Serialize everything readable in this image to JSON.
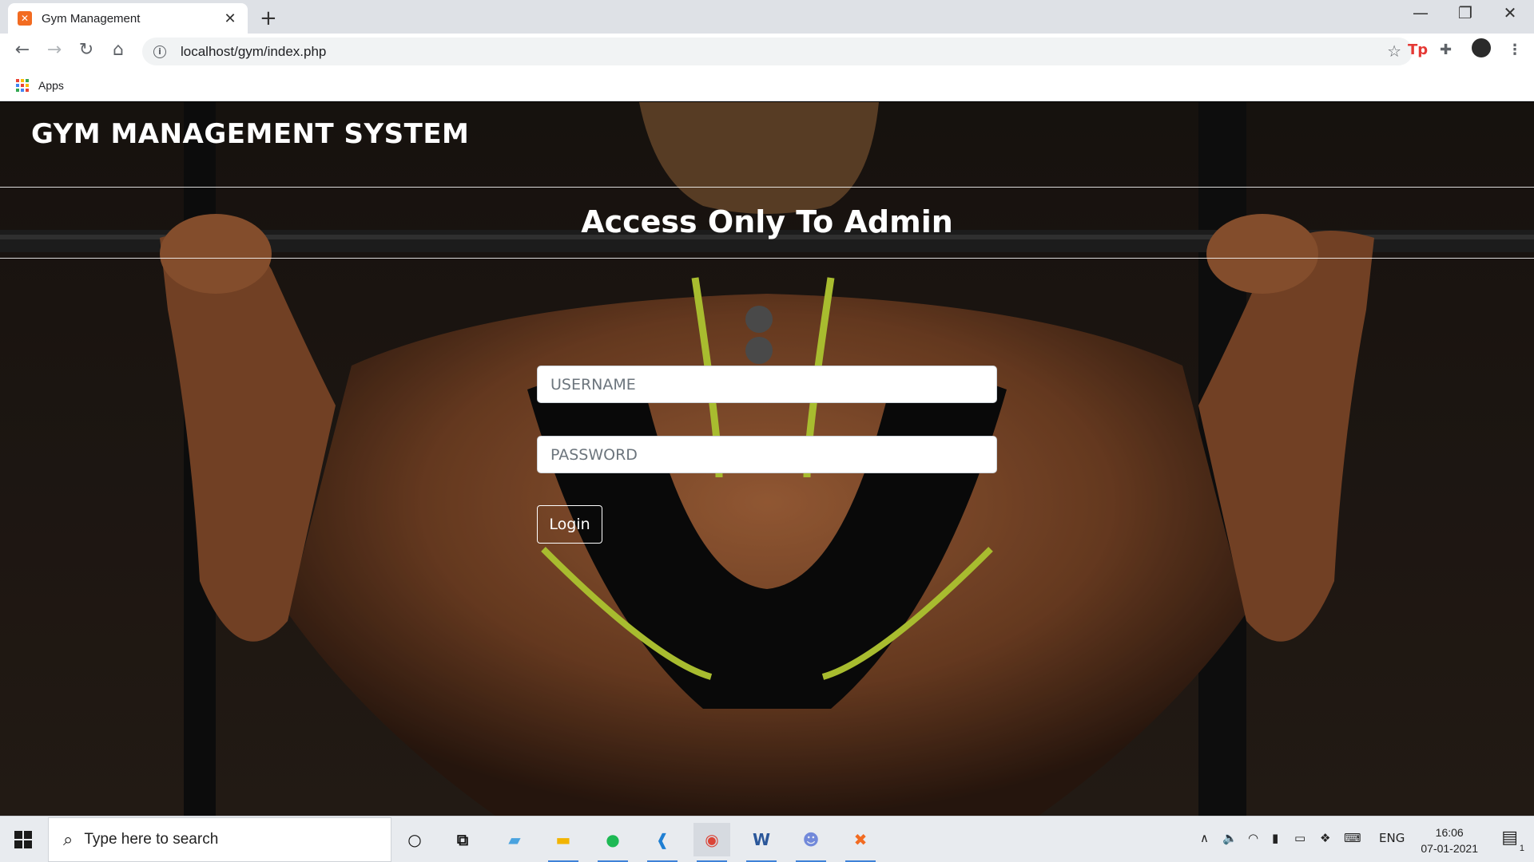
{
  "browser": {
    "tab_title": "Gym Management",
    "tab_favicon": "xampp-icon",
    "url": "localhost/gym/index.php",
    "bookmarks_apps_label": "Apps"
  },
  "page": {
    "site_title": "GYM MANAGEMENT SYSTEM",
    "subtitle": "Access Only To Admin",
    "username_placeholder": "USERNAME",
    "password_placeholder": "PASSWORD",
    "login_label": "Login"
  },
  "taskbar": {
    "search_placeholder": "Type here to search",
    "apps": [
      "cortana-icon",
      "task-view-icon",
      "desktop-app-icon",
      "file-explorer-icon",
      "spotify-icon",
      "vscode-icon",
      "chrome-icon",
      "word-icon",
      "discord-icon",
      "xampp-icon"
    ],
    "language": "ENG",
    "time": "16:06",
    "date": "07-01-2021",
    "notification_count": "1"
  },
  "colors": {
    "accent": "#3f82d8",
    "xampp_orange": "#f26b21",
    "page_bg": "#171310"
  }
}
